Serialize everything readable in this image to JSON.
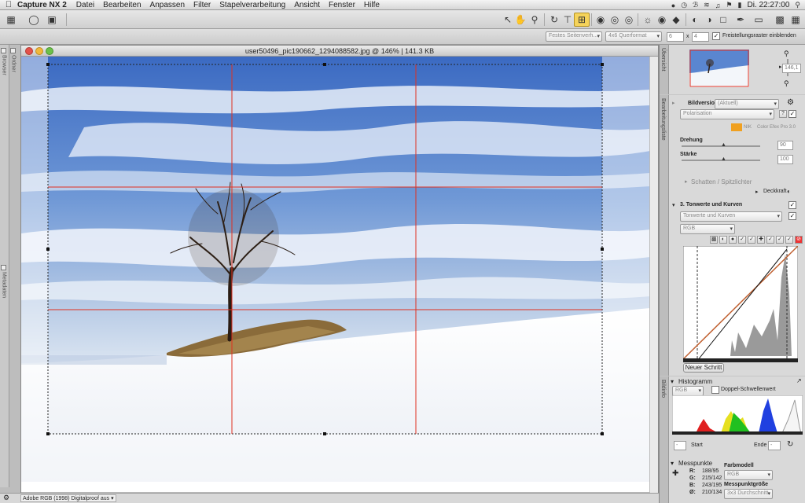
{
  "menubar": {
    "apple": "",
    "app_name": "Capture NX 2",
    "items": [
      "Datei",
      "Bearbeiten",
      "Anpassen",
      "Filter",
      "Stapelverarbeitung",
      "Ansicht",
      "Fenster",
      "Hilfe"
    ],
    "clock": "Di. 22:27:00"
  },
  "toolbar": {
    "tools": [
      "arrow-icon",
      "hand-icon",
      "zoom-icon",
      "rotate-icon",
      "straighten-icon",
      "crop-icon",
      "redeye-icon",
      "spot-heal-icon",
      "selection-control-point-icon",
      "auto-retouch-icon",
      "color-control-point-icon",
      "black-point-icon",
      "white-point-icon",
      "lasso-icon",
      "marquee-icon",
      "brush-icon",
      "fill-icon",
      "gradient-icon"
    ],
    "active_tool": "crop-icon"
  },
  "options": {
    "ratio_select": "Festes Seitenverh...",
    "format_select": "4x6 Querformat",
    "width_value": "6",
    "times": "x",
    "height_value": "4",
    "grid_checkbox_label": "Freistellungsraster einblenden",
    "grid_checked": true
  },
  "left_rail": {
    "tabs": [
      "Browser",
      "Ordner",
      "Metadaten"
    ]
  },
  "document": {
    "title": "user50496_pic190662_1294088582.jpg @ 146% | 141.3 KB"
  },
  "status": {
    "text": "Adobe RGB (1998) Digitalproof aus"
  },
  "right_panel": {
    "tabs": [
      "Übersicht",
      "Bearbeitungsliste",
      "Bildinfo"
    ],
    "overview": {
      "zoom_value": "146,1"
    },
    "edit_list": {
      "bildversion_label": "Bildversion",
      "bildversion_value": "(Aktuell)",
      "filter_select": "Polarisation",
      "filter_preset": "Color Efex Pro 3.0",
      "drehung_label": "Drehung",
      "drehung_value": "90",
      "staerke_label": "Stärke",
      "staerke_value": "100",
      "shadow_section": "Schatten / Spitzlichter",
      "deckkraft_label": "Deckkraft",
      "step_label": "3. Tonwerte und Kurven",
      "step_select": "Tonwerte und Kurven",
      "channel_select": "RGB",
      "new_step_button": "Neuer Schritt"
    },
    "histogram": {
      "title": "Histogramm",
      "channel": "RGB",
      "doppel_label": "Doppel-Schwellenwert",
      "start_value": "-",
      "start_label": "Start",
      "end_label": "Ende",
      "end_value": "-"
    },
    "messpunkte": {
      "title": "Messpunkte",
      "r_label": "R:",
      "r_value": "188/95",
      "g_label": "G:",
      "g_value": "215/142",
      "b_label": "B:",
      "b_value": "243/195",
      "o_label": "Ø:",
      "o_value": "210/134",
      "farbmodell_label": "Farbmodell",
      "farbmodell_value": "RGB",
      "groesse_label": "Messpunktgröße",
      "groesse_value": "3x3 Durchschnitt"
    }
  },
  "colors": {
    "sky_top": "#3f70c8",
    "sky_bottom": "#c5d6ea",
    "snow": "#f4f6f9",
    "crop_grid": "#e03020",
    "active_tool": "#f5d35a"
  }
}
